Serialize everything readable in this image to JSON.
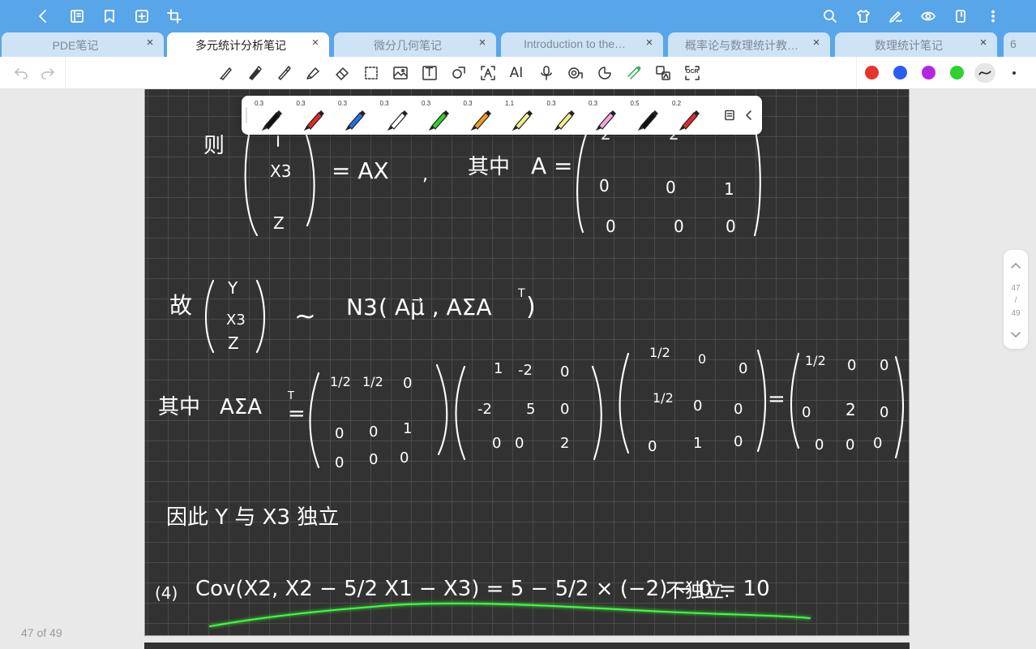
{
  "colors": {
    "topbar": "#58a5ea",
    "tab_inactive": "#cfe3f6",
    "canvas": "#323232",
    "highlight": "#3cff3c"
  },
  "topbar": {
    "left_icons": [
      "back-icon",
      "notebook-icon",
      "bookmark-icon",
      "add-page-icon",
      "crop-icon"
    ],
    "right_icons": [
      "search-icon",
      "theme-shirt-icon",
      "pen-sign-icon",
      "eye-icon",
      "device-icon",
      "more-icon"
    ]
  },
  "tabs": [
    {
      "label": "PDE笔记",
      "active": false
    },
    {
      "label": "多元统计分析笔记",
      "active": true
    },
    {
      "label": "微分几何笔记",
      "active": false
    },
    {
      "label": "Introduction to the…",
      "active": false
    },
    {
      "label": "概率论与数理统计教…",
      "active": false
    },
    {
      "label": "数理统计笔记",
      "active": false
    }
  ],
  "tab_overflow": "6",
  "tab_close_glyph": "×",
  "toolbar": {
    "tools": [
      "pencil-icon",
      "pen-icon",
      "fountain-pen-icon",
      "highlighter-icon",
      "eraser-icon",
      "lasso-select-icon",
      "image-icon",
      "text-box-icon",
      "shape-icon",
      "text-recognize-icon",
      "ai-icon",
      "microphone-icon",
      "tape-icon",
      "sticker-icon",
      "laser-pointer-icon",
      "translate-icon",
      "ocr-icon"
    ],
    "text_tool_label": "T",
    "ai_label": "AI",
    "ocr_label": "OCR",
    "colors": [
      "#e8332a",
      "#2a5cf0",
      "#b326e0",
      "#2fd12f"
    ]
  },
  "pen_palette": {
    "pens": [
      {
        "size": "0.3",
        "color": "#111111"
      },
      {
        "size": "0.3",
        "color": "#e02a2a"
      },
      {
        "size": "0.3",
        "color": "#2a6ee0"
      },
      {
        "size": "0.3",
        "color": "#ffffff"
      },
      {
        "size": "0.3",
        "color": "#2fd12f"
      },
      {
        "size": "0.3",
        "color": "#f0a020"
      },
      {
        "size": "1.1",
        "color": "#f0f08a"
      },
      {
        "size": "0.3",
        "color": "#f0f08a"
      },
      {
        "size": "0.3",
        "color": "#f4a8d8"
      },
      {
        "size": "0.5",
        "color": "#111111"
      },
      {
        "size": "0.2",
        "color": "#e02a2a"
      }
    ]
  },
  "page_nav": {
    "current": "47",
    "separator": "/",
    "total": "49"
  },
  "page_indicator": "47 of 49",
  "notes": {
    "ze": "则",
    "x3": "X3",
    "z": "Z",
    "eq_ax": "= AX",
    "comma": ",",
    "qizhong": "其中",
    "a_eq": "A =",
    "m0_r2": [
      "0",
      "0",
      "1"
    ],
    "m0_r3": [
      "0",
      "0",
      "0"
    ],
    "m0_r1": [
      "2",
      "2"
    ],
    "gu": "故",
    "y": "Y",
    "x3b": "X3",
    "zb": "Z",
    "sim": "~",
    "n3": "N3",
    "n3_args": "( Aμ⃗ ,  AΣA",
    "sup_t": "T",
    "close_paren": ")",
    "qizhong2": "其中",
    "asat": "AΣA",
    "eq": "=",
    "m1": [
      [
        "1/2",
        "1/2",
        "0"
      ],
      [
        "0",
        "0",
        "1"
      ],
      [
        "0",
        "0",
        "0"
      ]
    ],
    "m2": [
      [
        "1",
        "-2",
        "0"
      ],
      [
        "-2",
        "5",
        "0"
      ],
      [
        "0",
        "0",
        "2"
      ]
    ],
    "m3": [
      [
        "1/2",
        "0",
        "0"
      ],
      [
        "1/2",
        "0",
        "0"
      ],
      [
        "0",
        "1",
        "0"
      ]
    ],
    "m4": [
      [
        "1/2",
        "0",
        "0"
      ],
      [
        "0",
        "2",
        "0"
      ],
      [
        "0",
        "0",
        "0"
      ]
    ],
    "independent": "因此 Y 与 X3 独立",
    "part4": "(4)",
    "cov_expr": "Cov(X2,  X2 − 5/2 X1 − X3)  =  5 − 5/2 × (−2) − 0  =  10",
    "not_independent": "不独立."
  }
}
